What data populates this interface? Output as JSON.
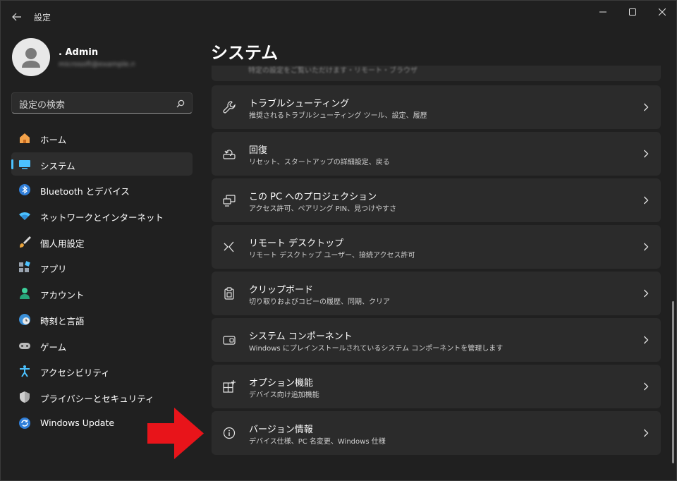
{
  "window": {
    "title": "設定",
    "controls": [
      "minimize",
      "maximize",
      "close"
    ]
  },
  "profile": {
    "name": ". Admin",
    "email": "microsoft@example.net"
  },
  "search": {
    "placeholder": "設定の検索"
  },
  "sidebar": {
    "items": [
      {
        "label": "ホーム",
        "icon": "home-icon"
      },
      {
        "label": "システム",
        "icon": "system-icon",
        "selected": true
      },
      {
        "label": "Bluetooth とデバイス",
        "icon": "bluetooth-icon"
      },
      {
        "label": "ネットワークとインターネット",
        "icon": "wifi-icon"
      },
      {
        "label": "個人用設定",
        "icon": "brush-icon"
      },
      {
        "label": "アプリ",
        "icon": "apps-icon"
      },
      {
        "label": "アカウント",
        "icon": "account-icon"
      },
      {
        "label": "時刻と言語",
        "icon": "time-language-icon"
      },
      {
        "label": "ゲーム",
        "icon": "gamepad-icon"
      },
      {
        "label": "アクセシビリティ",
        "icon": "accessibility-icon"
      },
      {
        "label": "プライバシーとセキュリティ",
        "icon": "shield-icon"
      },
      {
        "label": "Windows Update",
        "icon": "windows-update-icon"
      }
    ]
  },
  "main": {
    "title": "システム",
    "cut_card_text": "特定の設定をご覧いただけます・リモート・ブラウザ",
    "cards": [
      {
        "title": "トラブルシューティング",
        "subtitle": "推奨されるトラブルシューティング ツール、設定、履歴",
        "icon": "wrench-icon"
      },
      {
        "title": "回復",
        "subtitle": "リセット、スタートアップの詳細設定、戻る",
        "icon": "recovery-icon"
      },
      {
        "title": "この PC へのプロジェクション",
        "subtitle": "アクセス許可、ペアリング PIN、見つけやすさ",
        "icon": "projection-icon"
      },
      {
        "title": "リモート デスクトップ",
        "subtitle": "リモート デスクトップ ユーザー、接続アクセス許可",
        "icon": "remote-desktop-icon"
      },
      {
        "title": "クリップボード",
        "subtitle": "切り取りおよびコピーの履歴、同期、クリア",
        "icon": "clipboard-icon"
      },
      {
        "title": "システム コンポーネント",
        "subtitle": "Windows にプレインストールされているシステム コンポーネントを管理します",
        "icon": "system-components-icon"
      },
      {
        "title": "オプション機能",
        "subtitle": "デバイス向け追加機能",
        "icon": "optional-features-icon"
      },
      {
        "title": "バージョン情報",
        "subtitle": "デバイス仕様、PC 名変更、Windows 仕様",
        "icon": "info-icon"
      }
    ]
  },
  "colors": {
    "background": "#202020",
    "card": "#2b2b2b",
    "accent": "#4cc2ff",
    "annotation_arrow": "#e8141a"
  }
}
